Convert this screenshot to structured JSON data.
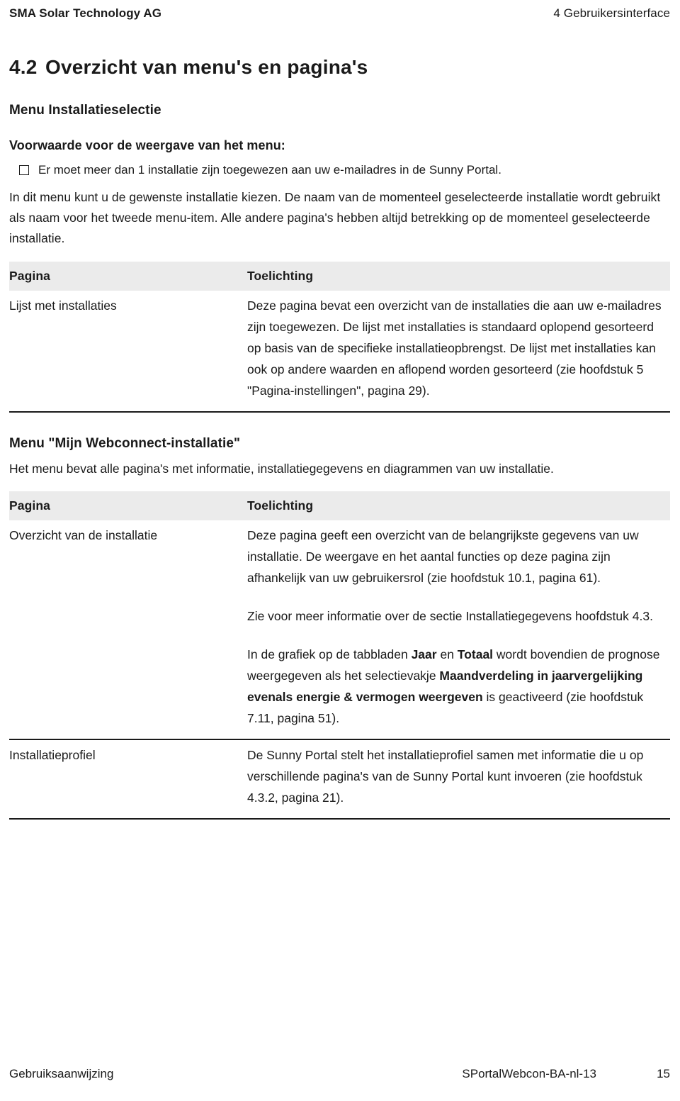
{
  "header": {
    "company": "SMA Solar Technology AG",
    "chapter": "4 Gebruikersinterface"
  },
  "section": {
    "number": "4.2",
    "title": "Overzicht van menu's en pagina's"
  },
  "menu_installatieselectie": {
    "heading": "Menu Installatieselectie",
    "condition_heading": "Voorwaarde voor de weergave van het menu:",
    "condition_item": "Er moet meer dan 1 installatie zijn toegewezen aan uw e-mailadres in de Sunny Portal.",
    "paragraph": "In dit menu kunt u de gewenste installatie kiezen. De naam van de momenteel geselecteerde installatie wordt gebruikt als naam voor het tweede menu-item. Alle andere pagina's hebben altijd betrekking op de momenteel geselecteerde installatie.",
    "table": {
      "columns": [
        "Pagina",
        "Toelichting"
      ],
      "rows": [
        {
          "page": "Lijst met installaties",
          "description": "Deze pagina bevat een overzicht van de installaties die aan uw e-mailadres zijn toegewezen. De lijst met installaties is standaard oplopend gesorteerd op basis van de specifieke installatieopbrengst. De lijst met installaties kan ook op andere waarden en aflopend worden gesorteerd (zie hoofdstuk 5 \"Pagina-instellingen\", pagina 29)."
        }
      ]
    }
  },
  "menu_webconnect": {
    "heading": "Menu \"Mijn Webconnect-installatie\"",
    "intro": "Het menu bevat alle pagina's met informatie, installatiegegevens en diagrammen van uw installatie.",
    "table": {
      "columns": [
        "Pagina",
        "Toelichting"
      ],
      "rows": [
        {
          "page": "Overzicht van de installatie",
          "paragraphs": [
            "Deze pagina geeft een overzicht van de belangrijkste gegevens van uw installatie. De weergave en het aantal functies op deze pagina zijn afhankelijk van uw gebruikersrol (zie hoofdstuk 10.1, pagina 61).",
            "Zie voor meer informatie over de sectie Installatiegegevens hoofdstuk 4.3.",
            "In de grafiek op de tabbladen Jaar en Totaal wordt bovendien de prognose weergegeven als het selectievakje Maandverdeling in jaarvergelijking evenals energie & vermogen weergeven is geactiveerd (zie hoofdstuk 7.11, pagina 51)."
          ],
          "paragraph3_parts": {
            "p1": "In de grafiek op de tabbladen ",
            "bold1": "Jaar",
            "p2": " en ",
            "bold2": "Totaal",
            "p3": " wordt bovendien de prognose weergegeven als het selectievakje ",
            "bold3": "Maandverdeling in jaarvergelijking evenals energie & vermogen weergeven",
            "p4": " is geactiveerd (zie hoofdstuk 7.11, pagina 51)."
          }
        },
        {
          "page": "Installatieprofiel",
          "description": "De Sunny Portal stelt het installatieprofiel samen met informatie die u op verschillende pagina's van de Sunny Portal kunt invoeren (zie hoofdstuk 4.3.2, pagina 21)."
        }
      ]
    }
  },
  "footer": {
    "left": "Gebruiksaanwijzing",
    "doc_id": "SPortalWebcon-BA-nl-13",
    "page_number": "15"
  }
}
